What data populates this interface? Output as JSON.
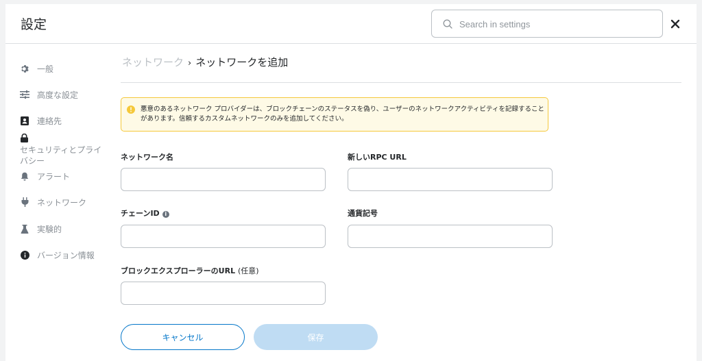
{
  "header": {
    "title": "設定",
    "search_placeholder": "Search in settings"
  },
  "sidebar": {
    "items": [
      {
        "label": "一般",
        "icon": "gear-icon"
      },
      {
        "label": "高度な設定",
        "icon": "sliders-icon"
      },
      {
        "label": "連絡先",
        "icon": "contact-book-icon"
      },
      {
        "label": "セキュリティとプライバシー",
        "icon": "lock-icon"
      },
      {
        "label": "アラート",
        "icon": "bell-icon"
      },
      {
        "label": "ネットワーク",
        "icon": "plug-icon"
      },
      {
        "label": "実験的",
        "icon": "flask-icon"
      },
      {
        "label": "バージョン情報",
        "icon": "info-icon"
      }
    ]
  },
  "breadcrumb": {
    "parent": "ネットワーク",
    "separator": "›",
    "current": "ネットワークを追加"
  },
  "warning": {
    "text": "悪意のあるネットワーク プロバイダーは、ブロックチェーンのステータスを偽り、ユーザーのネットワークアクティビティを記録することがあります。信頼するカスタムネットワークのみを追加してください。"
  },
  "form": {
    "network_name_label": "ネットワーク名",
    "rpc_url_label": "新しいRPC URL",
    "chain_id_label": "チェーンID",
    "currency_symbol_label": "通貨記号",
    "explorer_url_label": "ブロックエクスプローラーのURL",
    "explorer_url_optional": "(任意)",
    "network_name_value": "",
    "rpc_url_value": "",
    "chain_id_value": "",
    "currency_symbol_value": "",
    "explorer_url_value": ""
  },
  "buttons": {
    "cancel": "キャンセル",
    "save": "保存"
  },
  "colors": {
    "primary": "#0376c9",
    "save_disabled": "#bfdcf3",
    "warning_bg": "#fefae6",
    "warning_border": "#f5c83a"
  }
}
